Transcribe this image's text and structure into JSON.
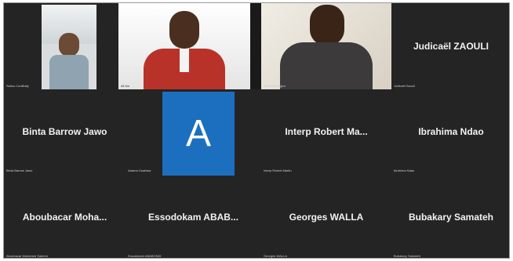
{
  "participants": [
    {
      "name": "",
      "caption": "Saliou Coulibaly",
      "kind": "video"
    },
    {
      "name": "",
      "caption": "Ali Ibo",
      "kind": "video"
    },
    {
      "name": "",
      "caption": "Justin Houngbo",
      "kind": "video"
    },
    {
      "name": "Judicaël ZAOULI",
      "caption": "Judicaël Zaouli",
      "kind": "name"
    },
    {
      "name": "Binta Barrow Jawo",
      "caption": "Binta Barrow Jawo",
      "kind": "name"
    },
    {
      "name": "",
      "caption": "Adama Ouattara",
      "kind": "avatar",
      "initial": "A"
    },
    {
      "name": "Interp  Robert  Ma...",
      "caption": "Interp Robert Martin",
      "kind": "name"
    },
    {
      "name": "Ibrahima Ndao",
      "caption": "Ibrahima Ndao",
      "kind": "name"
    },
    {
      "name": "Aboubacar  Moha...",
      "caption": "Aboubacar Mohamed Saleem",
      "kind": "name"
    },
    {
      "name": "Essodokam  ABAB...",
      "caption": "Essodokam ABABONDI",
      "kind": "name"
    },
    {
      "name": "Georges WALLA",
      "caption": "Georges WALLA",
      "kind": "name"
    },
    {
      "name": "Bubakary Samateh",
      "caption": "Bubakary Samateh",
      "kind": "name"
    }
  ],
  "colors": {
    "background": "#1a1a1a",
    "tile": "#242424",
    "avatar": "#1c6fbf"
  }
}
